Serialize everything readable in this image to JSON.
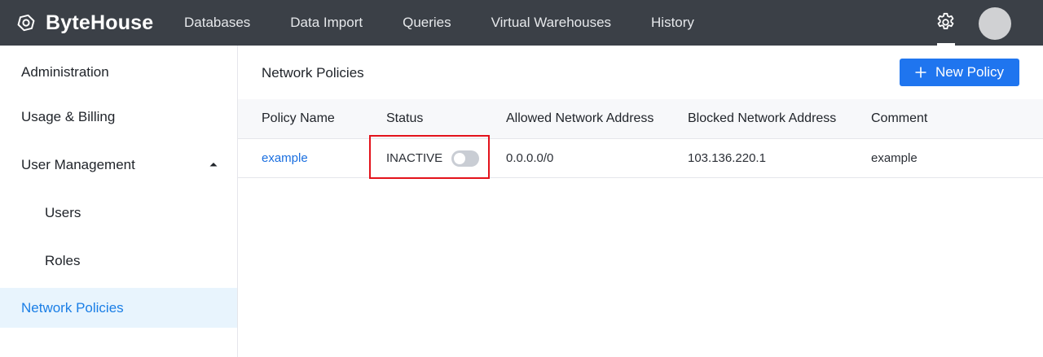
{
  "app": {
    "brand": "ByteHouse"
  },
  "nav": {
    "items": [
      {
        "label": "Databases"
      },
      {
        "label": "Data Import"
      },
      {
        "label": "Queries"
      },
      {
        "label": "Virtual Warehouses"
      },
      {
        "label": "History"
      }
    ]
  },
  "sidebar": {
    "heading": "Administration",
    "items": [
      {
        "label": "Usage & Billing"
      },
      {
        "label": "User Management",
        "expanded": true
      },
      {
        "label": "Users"
      },
      {
        "label": "Roles"
      },
      {
        "label": "Network Policies",
        "active": true
      }
    ]
  },
  "main": {
    "title": "Network Policies",
    "new_button_label": "New Policy",
    "table": {
      "columns": [
        "Policy Name",
        "Status",
        "Allowed Network Address",
        "Blocked Network Address",
        "Comment"
      ],
      "rows": [
        {
          "policy_name": "example",
          "status": "INACTIVE",
          "enabled": false,
          "allowed": "0.0.0.0/0",
          "blocked": "103.136.220.1",
          "comment": "example"
        }
      ]
    }
  },
  "colors": {
    "topbar": "#3b4047",
    "accent": "#1f75ef",
    "active_bg": "#e8f4fd",
    "highlight": "#e3121b"
  }
}
